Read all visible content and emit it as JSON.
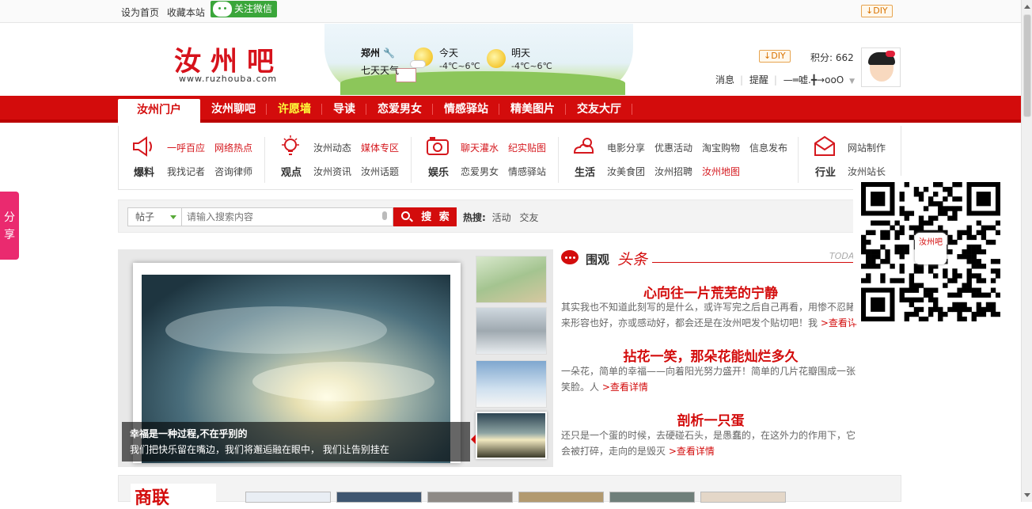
{
  "topbar": {
    "set_home": "设为首页",
    "bookmark": "收藏本站",
    "wechat_follow": "关注微信",
    "diy": "DIY"
  },
  "header": {
    "logo_text": "汝州吧",
    "logo_url": "www.ruzhouba.com",
    "weather": {
      "city": "郑州",
      "seven_day": "七天天气",
      "today_label": "今天",
      "today_temp": "-4℃~6℃",
      "tomorrow_label": "明天",
      "tomorrow_temp": "-4℃~6℃"
    },
    "user": {
      "diy": "DIY",
      "score": "积分: 662",
      "messages": "消息",
      "reminders": "提醒",
      "username": "—═嘘.╋→ooO"
    }
  },
  "nav": {
    "items": [
      "汝州门户",
      "汝州聊吧",
      "许愿墙",
      "导读",
      "恋爱男女",
      "情感驿站",
      "精美图片",
      "交友大厅"
    ]
  },
  "categories": [
    {
      "name": "爆料",
      "icon": "megaphone-icon",
      "links": [
        "一呼百应",
        "网络热点",
        "我找记者",
        "咨询律师"
      ]
    },
    {
      "name": "观点",
      "icon": "lightbulb-icon",
      "links": [
        "汝州动态",
        "媒体专区",
        "汝州资讯",
        "汝州话题"
      ]
    },
    {
      "name": "娱乐",
      "icon": "camera-icon",
      "links": [
        "聊天灌水",
        "纪实贴图",
        "恋爱男女",
        "情感驿站"
      ]
    },
    {
      "name": "生活",
      "icon": "weather-icon",
      "links": [
        "电影分享",
        "优惠活动",
        "淘宝购物",
        "信息发布",
        "汝美食团",
        "汝州招聘",
        "汝州地图"
      ]
    },
    {
      "name": "行业",
      "icon": "envelope-icon",
      "links": [
        "网站制作",
        "汝州站长"
      ]
    }
  ],
  "search": {
    "type": "帖子",
    "placeholder": "请输入搜索内容",
    "button": "搜 索",
    "hot_label": "热搜:",
    "hot": [
      "活动",
      "交友"
    ]
  },
  "slideshow": {
    "caption_title": "幸福是一种过程,不在乎别的",
    "caption_text": "我们把快乐留在嘴边，我们将邂逅融在眼中， 我们让告别挂在"
  },
  "headlines": {
    "weiguan": "围观",
    "toutiao": "头条",
    "today": "TODAY",
    "more": ">查看详情",
    "items": [
      {
        "title": "心向往一片荒芜的宁静",
        "text": "其实我也不知道此刻写的是什么，或许写完之后自己再看，用惨不忍睹来形容也好，亦或感动好，都会还是在汝州吧发个贴切吧！我"
      },
      {
        "title": "拈花一笑，那朵花能灿烂多久",
        "text": "一朵花，简单的幸福——向着阳光努力盛开！简单的几片花瓣围成一张笑脸。人"
      },
      {
        "title": "剖析一只蛋",
        "text": "还只是一个蛋的时候，去硬碰石头，是愚蠢的，在这外力的作用下，它会被打碎，走向的是毁灭"
      }
    ]
  },
  "qr": {
    "badge": "汝州吧"
  },
  "share": {
    "label": "分享"
  },
  "bottom": {
    "logo": "商联"
  },
  "colors": {
    "brand_red": "#d30c0c",
    "share_pink": "#ea2a6f",
    "wechat_green": "#3aa63a"
  }
}
